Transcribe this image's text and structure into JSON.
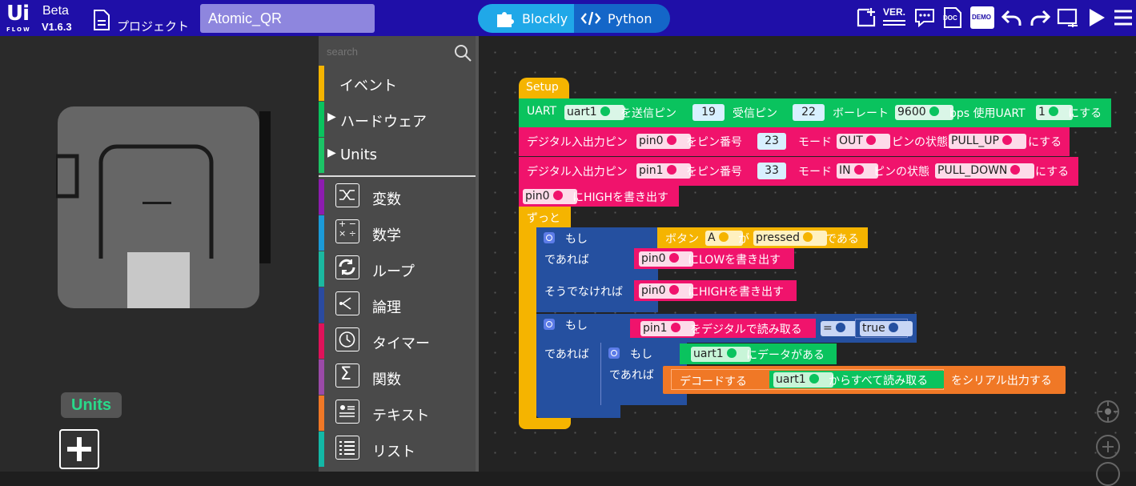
{
  "header": {
    "logo_text": "Ui",
    "logo_sub": "FLOW",
    "beta": "Beta",
    "version": "V1.6.3",
    "project_label": "プロジェクト",
    "project_name": "Atomic_QR",
    "mode_blockly": "Blockly",
    "mode_python": "Python",
    "toolbar_icons": [
      "new-file-icon",
      "version-icon",
      "chat-icon",
      "doc-icon",
      "demo-icon",
      "undo-icon",
      "redo-icon",
      "device-icon",
      "run-icon",
      "menu-icon"
    ],
    "ver_icon_text": "VER.",
    "doc_icon_text": "DOC",
    "demo_icon_text": "DEMO"
  },
  "left_panel": {
    "units_label": "Units"
  },
  "toolbox": {
    "search_placeholder": "search",
    "categories": [
      {
        "label": "イベント",
        "color": "#f5b400"
      },
      {
        "label": "ハードウェア",
        "color": "#0ac35e"
      },
      {
        "label": "Units",
        "color": "#1cc466"
      },
      {
        "label": "変数",
        "color": "#8d1cb0"
      },
      {
        "label": "数学",
        "color": "#1b9ad8"
      },
      {
        "label": "ループ",
        "color": "#1bb8a0"
      },
      {
        "label": "論理",
        "color": "#2a4aa0"
      },
      {
        "label": "タイマー",
        "color": "#e0125a"
      },
      {
        "label": "関数",
        "color": "#9b4aa8"
      },
      {
        "label": "テキスト",
        "color": "#f07826"
      },
      {
        "label": "リスト",
        "color": "#13b8a6"
      }
    ]
  },
  "blocks": {
    "setup": "Setup",
    "uart": {
      "prefix": "UART",
      "name": "uart1",
      "tx_label": "を送信ピン",
      "tx": "19",
      "rx_label": "受信ピン",
      "rx": "22",
      "baud_label": "ボーレート",
      "baud": "9600",
      "bps_label": "bps 使用UART",
      "uart_num": "1",
      "suffix": "にする"
    },
    "pin0": {
      "prefix": "デジタル入出力ピン",
      "name": "pin0",
      "num_label": "をピン番号",
      "num": "23",
      "mode_label": "モード",
      "mode": "OUT",
      "state_label": "ピンの状態",
      "state": "PULL_UP",
      "suffix": "にする"
    },
    "pin1": {
      "prefix": "デジタル入出力ピン",
      "name": "pin1",
      "num_label": "をピン番号",
      "num": "33",
      "mode_label": "モード",
      "mode": "IN",
      "state_label": "ピンの状態",
      "state": "PULL_DOWN",
      "suffix": "にする"
    },
    "write_high": {
      "pin": "pin0",
      "text": "にHIGHを書き出す"
    },
    "forever": "ずっと",
    "if1": {
      "if": "もし",
      "then": "であれば",
      "else": "そうでなければ",
      "button_label": "ボタン",
      "button": "A",
      "ga": "が",
      "state": "pressed",
      "dearu": "である",
      "low_pin": "pin0",
      "low_text": "にLOWを書き出す",
      "high_pin": "pin0",
      "high_text": "にHIGHを書き出す"
    },
    "if2": {
      "if": "もし",
      "then": "であれば",
      "pin": "pin1",
      "read_text": "をデジタルで読み取る",
      "op": "=",
      "val": "true"
    },
    "if3": {
      "if": "もし",
      "then": "であれば",
      "uart": "uart1",
      "has_data": "にデータがある",
      "decode": "デコードする",
      "read_uart": "uart1",
      "read_all": "からすべて読み取る",
      "serial_out": "をシリアル出力する"
    }
  },
  "colors": {
    "topbar": "#1f0fa8",
    "event": "#f5b400",
    "hardware": "#0ac35e",
    "pin": "#f0136c",
    "logic": "#2550a0",
    "text": "#f07826"
  }
}
